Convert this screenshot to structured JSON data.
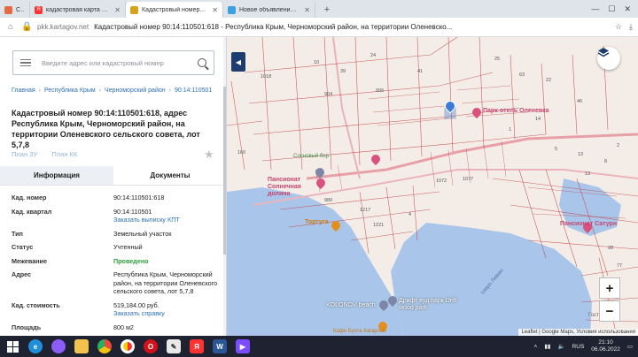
{
  "browser": {
    "tabs": [
      {
        "label": "Сеть",
        "icon": "grid-icon",
        "active": false
      },
      {
        "label": "кадастровая карта крым",
        "icon": "yandex-icon",
        "active": false
      },
      {
        "label": "Кадастровый номер 90",
        "icon": "kartagov-icon",
        "active": true
      },
      {
        "label": "Новое объявление — Ob",
        "icon": "avito-icon",
        "active": false
      }
    ],
    "domain": "pkk.kartagov.net",
    "page_title": "Кадастровый номер 90:14:110501:618 - Республика Крым, Черноморский район, на территории Оленевско..."
  },
  "panel": {
    "search_placeholder": "Введите адрес или кадастровый номер",
    "breadcrumbs": [
      "Главная",
      "Республика Крым",
      "Черноморский район",
      "90:14:110501"
    ],
    "title": "Кадастровый номер 90:14:110501:618, адрес Республика Крым, Черноморский район, на территории Оленевского сельского совета, лот 5,7,8",
    "plan_zu": "План ЗУ",
    "plan_kk": "План КК",
    "tabs": [
      "Информация",
      "Документы"
    ],
    "properties": {
      "cad_number": {
        "label": "Кад. номер",
        "value": "90:14:110501:618"
      },
      "cad_quarter": {
        "label": "Кад. квартал",
        "value": "90:14:110501",
        "link": "Заказать выписку КПТ"
      },
      "type": {
        "label": "Тип",
        "value": "Земельный участок"
      },
      "status": {
        "label": "Статус",
        "value": "Учтенный"
      },
      "survey": {
        "label": "Межевание",
        "value": "Проведено"
      },
      "address": {
        "label": "Адрес",
        "value": "Республика Крым, Черноморский район, на территории Оленевского сельского совета, лот 5,7,8"
      },
      "cad_cost": {
        "label": "Кад. стоимость",
        "value": "519,184.00 руб.",
        "link": "Заказать справку"
      },
      "area": {
        "label": "Площадь",
        "value": "800 м2"
      }
    }
  },
  "map": {
    "labels": {
      "park_hotel": "Парк-отель Оленевка",
      "pansionat_solnechnaya": "Пансионат Солнечная долина",
      "pansionat_satur": "Пансионат Сатурн",
      "tortuga": "Тортуга",
      "kolonov": "KOLONOV beach",
      "drift": "Дрифт вуд парк Drift wood park",
      "cafe": "Кафе Бухта Кагарлык",
      "sosnovyi": "Сосновый бор",
      "lake": "озеро Лиман",
      "hotel": "Гостев"
    },
    "parcel_numbers": [
      "1018",
      "904",
      "906",
      "10",
      "24",
      "39",
      "41",
      "25",
      "22",
      "46",
      "14",
      "63",
      "160",
      "5",
      "13",
      "13",
      "8",
      "2",
      "1221",
      "980",
      "1072",
      "1077",
      "1217",
      "4",
      "28",
      "77",
      "1"
    ],
    "zoom_in": "+",
    "zoom_out": "−",
    "attribution": "Leaflet | Google Maps, Условия использования"
  },
  "taskbar": {
    "time": "21:10",
    "date": "06.06.2022",
    "lang": "RUS",
    "apps": [
      "start-icon",
      "edge-icon",
      "alice-icon",
      "explorer-icon",
      "chrome-icon",
      "yandex-browser-icon",
      "opera-icon",
      "paint-icon",
      "yandex-icon",
      "word-icon",
      "media-icon"
    ]
  },
  "colors": {
    "link": "#2d6fb5",
    "green": "#2e9d3a",
    "parcel_line": "#c0464a",
    "water": "#a9c6ea",
    "poi_pink": "#d9517f",
    "sidebar_toggle": "#1f3c70"
  }
}
